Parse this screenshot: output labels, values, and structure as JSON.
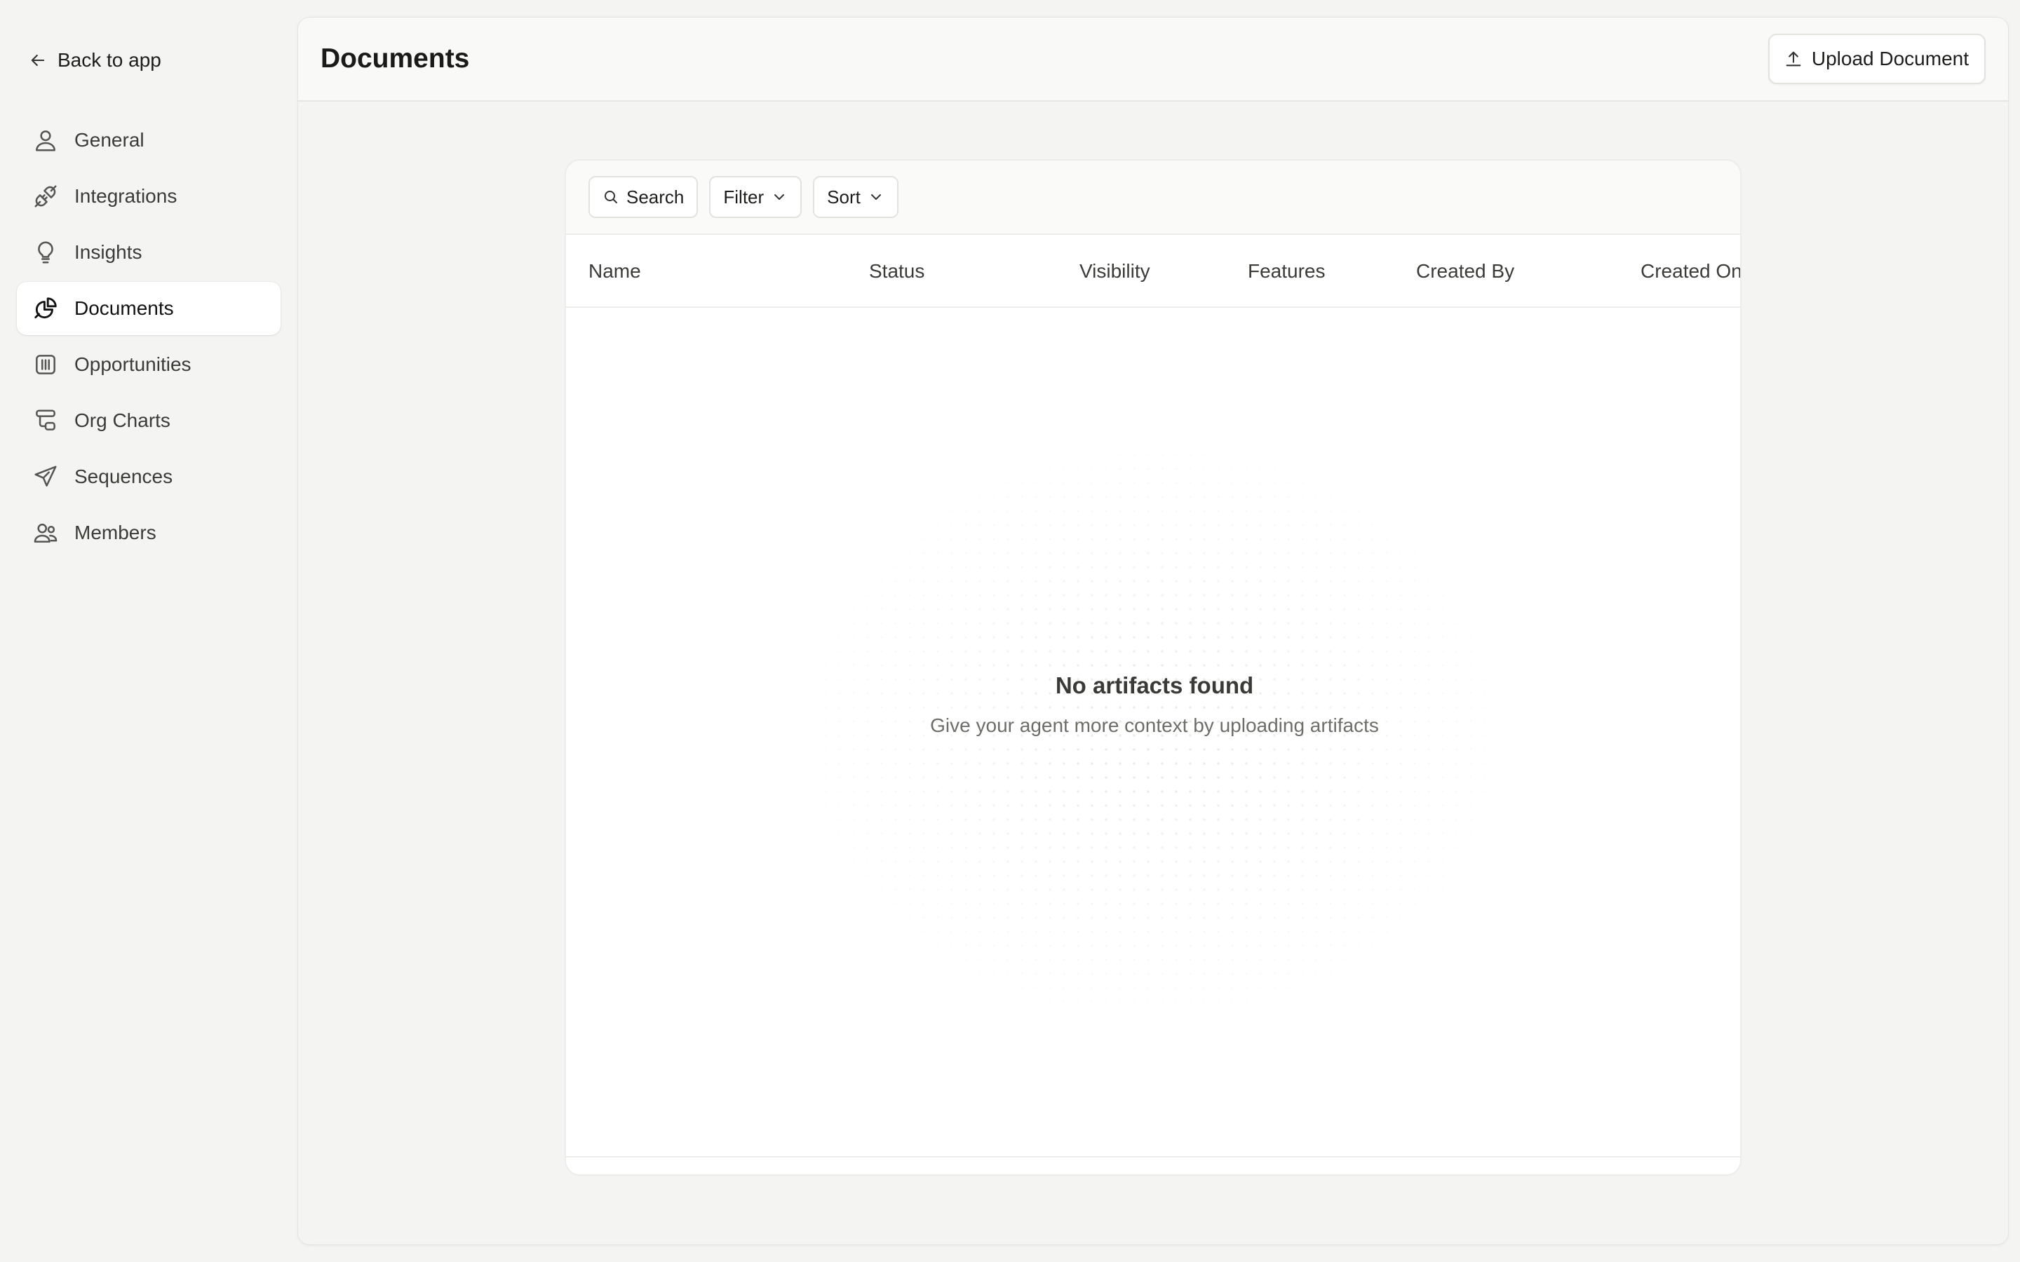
{
  "sidebar": {
    "back_label": "Back to app",
    "items": [
      {
        "label": "General",
        "icon": "user-icon",
        "active": false
      },
      {
        "label": "Integrations",
        "icon": "plug-icon",
        "active": false
      },
      {
        "label": "Insights",
        "icon": "lightbulb-icon",
        "active": false
      },
      {
        "label": "Documents",
        "icon": "documents-icon",
        "active": true
      },
      {
        "label": "Opportunities",
        "icon": "opportunities-icon",
        "active": false
      },
      {
        "label": "Org Charts",
        "icon": "org-chart-icon",
        "active": false
      },
      {
        "label": "Sequences",
        "icon": "send-icon",
        "active": false
      },
      {
        "label": "Members",
        "icon": "members-icon",
        "active": false
      }
    ]
  },
  "header": {
    "title": "Documents",
    "upload_label": "Upload Document"
  },
  "toolbar": {
    "search_label": "Search",
    "filter_label": "Filter",
    "sort_label": "Sort"
  },
  "table": {
    "columns": [
      "Name",
      "Status",
      "Visibility",
      "Features",
      "Created By",
      "Created On"
    ]
  },
  "empty_state": {
    "title": "No artifacts found",
    "subtitle": "Give your agent more context by uploading artifacts"
  },
  "colors": {
    "background": "#f4f4f2",
    "panel": "#ffffff",
    "text": "#1d1d1b",
    "muted": "#6e6e69"
  }
}
